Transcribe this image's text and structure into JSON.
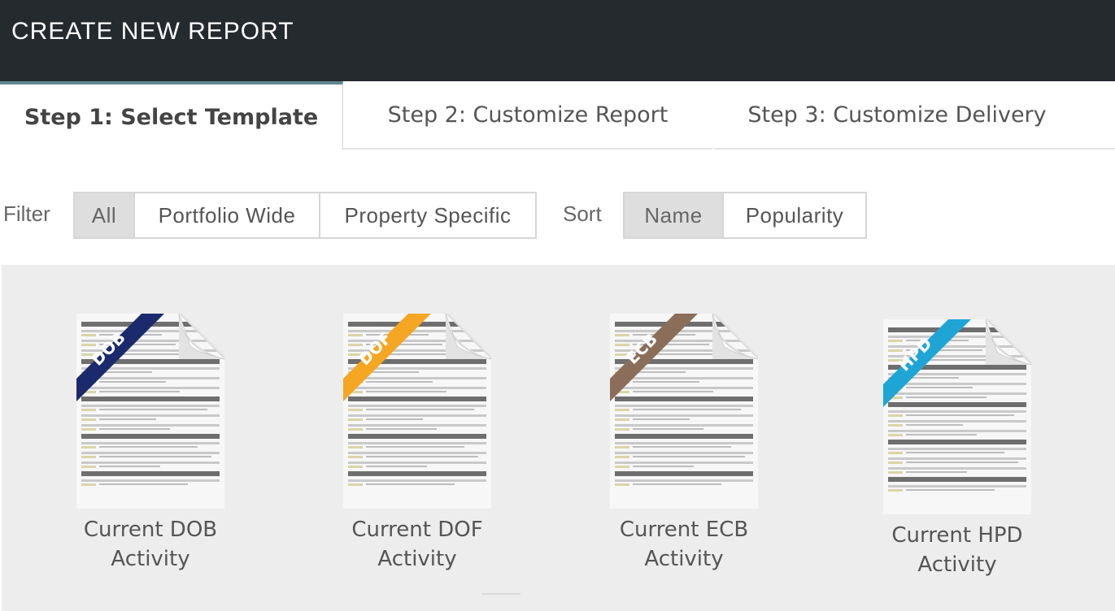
{
  "header": {
    "title": "CREATE NEW REPORT"
  },
  "tabs": [
    {
      "label": "Step 1: Select Template",
      "active": true
    },
    {
      "label": "Step 2: Customize Report",
      "active": false
    },
    {
      "label": "Step 3: Customize Delivery",
      "active": false
    }
  ],
  "filter": {
    "label": "Filter",
    "options": [
      "All",
      "Portfolio Wide",
      "Property Specific"
    ],
    "selected": "All"
  },
  "sort": {
    "label": "Sort",
    "options": [
      "Name",
      "Popularity"
    ],
    "selected": "Name"
  },
  "templates": [
    {
      "ribbon": "DOB",
      "ribbon_color": "#1a2a6c",
      "label_line1": "Current DOB",
      "label_line2": "Activity"
    },
    {
      "ribbon": "DOF",
      "ribbon_color": "#f5a623",
      "label_line1": "Current DOF",
      "label_line2": "Activity"
    },
    {
      "ribbon": "ECB",
      "ribbon_color": "#8b6e5a",
      "label_line1": "Current ECB",
      "label_line2": "Activity"
    },
    {
      "ribbon": "HPD",
      "ribbon_color": "#1ea5d6",
      "label_line1": "Current HPD",
      "label_line2": "Activity"
    }
  ],
  "icons": {
    "document": "document-icon"
  }
}
